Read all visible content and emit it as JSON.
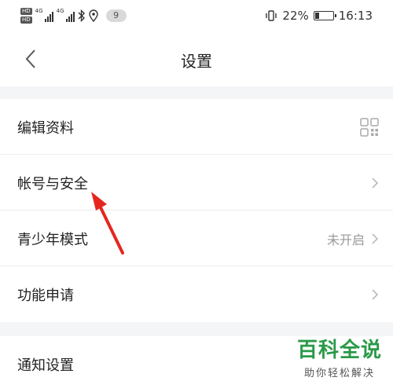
{
  "status_bar": {
    "hd1": "HD",
    "hd2": "HD",
    "net1": "4G",
    "net2": "4G",
    "badge": "9",
    "battery_percent": "22%",
    "battery_level": 0.22,
    "time": "16:13"
  },
  "header": {
    "title": "设置"
  },
  "rows": [
    {
      "label": "编辑资料",
      "value": "",
      "trailing_icon": "qr-code-icon"
    },
    {
      "label": "帐号与安全",
      "value": "",
      "trailing_icon": "chevron-right-icon"
    },
    {
      "label": "青少年模式",
      "value": "未开启",
      "trailing_icon": "chevron-right-icon"
    },
    {
      "label": "功能申请",
      "value": "",
      "trailing_icon": "chevron-right-icon"
    },
    {
      "label": "通知设置",
      "value": "",
      "trailing_icon": ""
    }
  ],
  "annotation": {
    "color": "#e5261f"
  },
  "watermark": {
    "logo": "百科全说",
    "slogan": "助你轻松解决",
    "color": "#2a9a47"
  }
}
